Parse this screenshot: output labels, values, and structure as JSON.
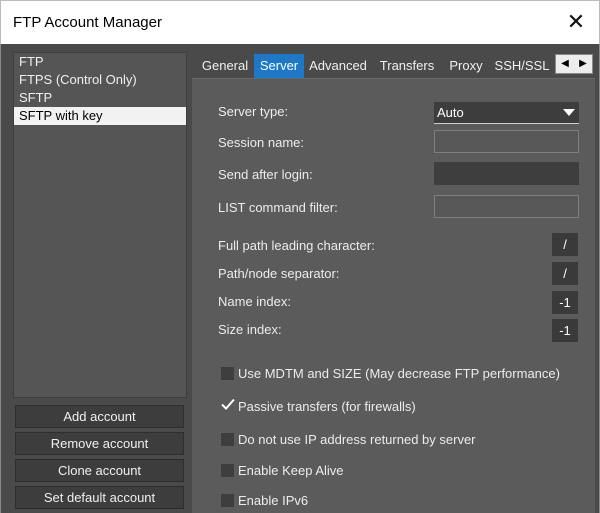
{
  "window": {
    "title": "FTP Account Manager"
  },
  "accounts": [
    {
      "label": "FTP",
      "selected": false
    },
    {
      "label": "FTPS (Control Only)",
      "selected": false
    },
    {
      "label": "SFTP",
      "selected": false
    },
    {
      "label": "SFTP with key",
      "selected": true
    }
  ],
  "buttons": {
    "add": "Add account",
    "remove": "Remove account",
    "clone": "Clone account",
    "set_default": "Set default account"
  },
  "tabs": [
    {
      "label": "General",
      "active": false
    },
    {
      "label": "Server",
      "active": true
    },
    {
      "label": "Advanced",
      "active": false
    },
    {
      "label": "Transfers",
      "active": false
    },
    {
      "label": "Proxy",
      "active": false
    },
    {
      "label": "SSH/SSL",
      "active": false
    }
  ],
  "server": {
    "server_type_label": "Server type:",
    "server_type_value": "Auto",
    "session_name_label": "Session name:",
    "session_name_value": "",
    "send_after_login_label": "Send after login:",
    "send_after_login_value": "",
    "list_filter_label": "LIST command filter:",
    "list_filter_value": "",
    "full_path_label": "Full path leading character:",
    "full_path_value": "/",
    "separator_label": "Path/node separator:",
    "separator_value": "/",
    "name_index_label": "Name index:",
    "name_index_value": "-1",
    "size_index_label": "Size index:",
    "size_index_value": "-1"
  },
  "options": [
    {
      "label": "Use MDTM and SIZE (May decrease FTP performance)",
      "checked": false
    },
    {
      "label": "Passive transfers (for firewalls)",
      "checked": true
    },
    {
      "label": "Do not use IP address returned by server",
      "checked": false
    },
    {
      "label": "Enable Keep Alive",
      "checked": false
    },
    {
      "label": "Enable IPv6",
      "checked": false
    }
  ],
  "colors": {
    "active_tab": "#1e78c8",
    "panel_bg": "#5b5b5b",
    "window_bg": "#4a4a4a"
  }
}
